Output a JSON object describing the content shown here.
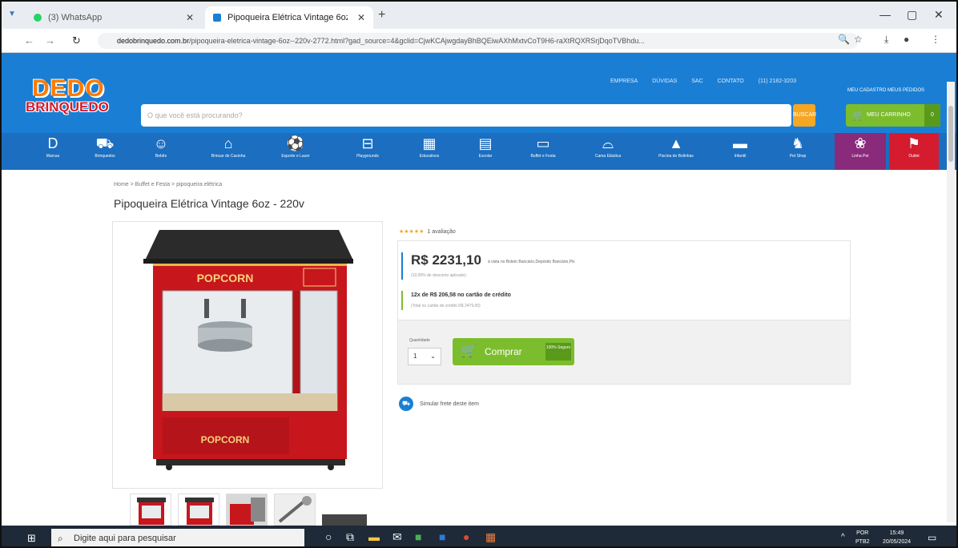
{
  "browser": {
    "tabs": [
      {
        "label": "(3) WhatsApp",
        "active": false
      },
      {
        "label": "Pipoqueira Elétrica Vintage 6oz",
        "active": true
      }
    ],
    "url_host": "dedobrinquedo.com.br",
    "url_path": "/pipoqueira-eletrica-vintage-6oz--220v-2772.html?gad_source=4&gclid=CjwKCAjwgdayBhBQEiwAXhMxtvCoT9H6-raXtRQXRSrjDqoTVBhdu..."
  },
  "site": {
    "logo_top": "DEDO",
    "logo_bottom": "BRINQUEDO",
    "top_links": [
      "EMPRESA",
      "DÚVIDAS",
      "SAC",
      "CONTATO",
      "(11) 2182-3203"
    ],
    "account_links": "MEU CADASTRO   MEUS PEDIDOS",
    "search_placeholder": "O que você está procurando?",
    "search_button": "BUSCAR",
    "cart_label": "MEU CARRINHO",
    "cart_count": "0"
  },
  "categories": [
    {
      "label": "Marcas",
      "icon": "D"
    },
    {
      "label": "Brinquedos",
      "icon": "⛟"
    },
    {
      "label": "Bebês",
      "icon": "☺"
    },
    {
      "label": "Brincar de Casinha",
      "icon": "⌂"
    },
    {
      "label": "Esporte e Lazer",
      "icon": "⚽"
    },
    {
      "label": "Playgrounds",
      "icon": "⊟"
    },
    {
      "label": "Educativos",
      "icon": "▦"
    },
    {
      "label": "Escolar",
      "icon": "▤"
    },
    {
      "label": "Buffet e Festa",
      "icon": "▭"
    },
    {
      "label": "Cama Elástica",
      "icon": "⌓"
    },
    {
      "label": "Piscina de Bolinhas",
      "icon": "▲"
    },
    {
      "label": "Infantil",
      "icon": "▬"
    },
    {
      "label": "Pet Shop",
      "icon": "♞"
    },
    {
      "label": "Linha Pet",
      "icon": "❀"
    },
    {
      "label": "Outlet",
      "icon": "⚑"
    }
  ],
  "product": {
    "breadcrumb": "Home  >  Buffet e Festa  >  pipoqueira elétrica",
    "title": "Pipoqueira Elétrica Vintage 6oz - 220v",
    "rating_stars": "★★★★★",
    "rating_count": "1 avaliação",
    "price": "R$ 2231,10",
    "price_note": "à vista no Boleto Bancário,Depósito Bancário,Pix",
    "discount_note": "(10,00% de desconto aplicado)",
    "installments": "12x de R$ 206,58 no cartão de crédito",
    "installments_total": "(Total no cartão de crédito R$ 2479,00)",
    "quantity_label": "Quantidade",
    "quantity_value": "1",
    "buy_button": "Comprar",
    "secure_badge": "100% Seguro",
    "shipping_link": "Simular frete deste item",
    "image_text_top": "POPCORN",
    "image_text_bottom": "POPCORN"
  },
  "taskbar": {
    "search_placeholder": "Digite aqui para pesquisar",
    "lang": "POR",
    "lang2": "PTB2",
    "time": "15:49",
    "date": "20/05/2024"
  },
  "colors": {
    "header_blue": "#1a7fd4",
    "nav_blue": "#1b6ec0",
    "buy_green": "#7cbd2e",
    "popcorn_red": "#c8161d",
    "logo_orange": "#ff7a00"
  }
}
